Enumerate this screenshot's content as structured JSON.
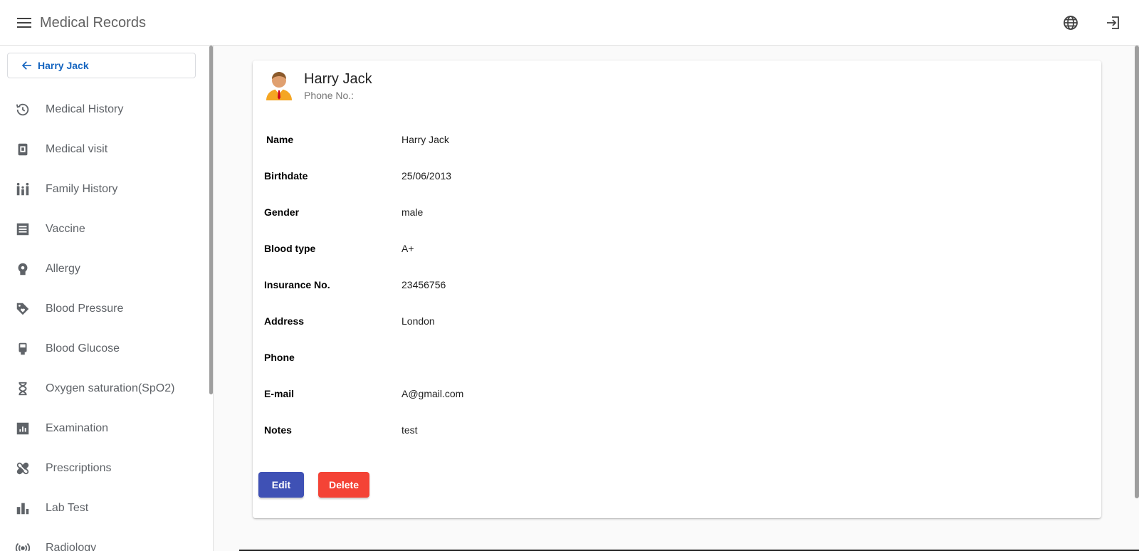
{
  "app": {
    "title": "Medical Records"
  },
  "header": {
    "menu_icon": "menu-icon",
    "language_icon": "globe-icon",
    "logout_icon": "logout-icon"
  },
  "sidebar": {
    "back_label": "Harry Jack",
    "items": [
      {
        "label": "Medical History",
        "icon": "history-icon"
      },
      {
        "label": "Medical visit",
        "icon": "visit-icon"
      },
      {
        "label": "Family History",
        "icon": "family-icon"
      },
      {
        "label": "Vaccine",
        "icon": "vaccine-icon"
      },
      {
        "label": "Allergy",
        "icon": "allergy-icon"
      },
      {
        "label": "Blood Pressure",
        "icon": "blood-pressure-icon"
      },
      {
        "label": "Blood Glucose",
        "icon": "blood-glucose-icon"
      },
      {
        "label": "Oxygen saturation(SpO2)",
        "icon": "hourglass-icon"
      },
      {
        "label": "Examination",
        "icon": "examination-icon"
      },
      {
        "label": "Prescriptions",
        "icon": "prescription-icon"
      },
      {
        "label": "Lab Test",
        "icon": "lab-test-icon"
      },
      {
        "label": "Radiology",
        "icon": "radiology-icon"
      }
    ]
  },
  "patient": {
    "name": "Harry Jack",
    "phone_label": "Phone No.:",
    "fields": [
      {
        "label": "Name",
        "value": "Harry Jack"
      },
      {
        "label": "Birthdate",
        "value": "25/06/2013"
      },
      {
        "label": "Gender",
        "value": "male"
      },
      {
        "label": "Blood type",
        "value": "A+"
      },
      {
        "label": "Insurance No.",
        "value": "23456756"
      },
      {
        "label": "Address",
        "value": "London"
      },
      {
        "label": "Phone",
        "value": ""
      },
      {
        "label": "E-mail",
        "value": "A@gmail.com"
      },
      {
        "label": "Notes",
        "value": "test"
      }
    ]
  },
  "actions": {
    "edit_label": "Edit",
    "delete_label": "Delete"
  },
  "colors": {
    "primary": "#3f51b5",
    "danger": "#f44336",
    "link": "#1565c0",
    "icon": "#5f6368"
  }
}
